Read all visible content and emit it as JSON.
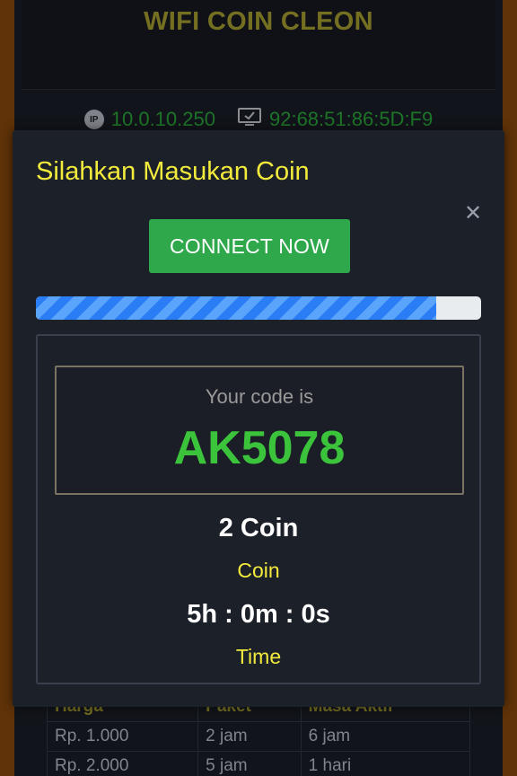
{
  "header": {
    "title": "WIFI COIN CLEON"
  },
  "info": {
    "ip_icon": "ip-badge-icon",
    "ip_icon_text": "IP",
    "ip": "10.0.10.250",
    "device_icon": "monitor-check-icon",
    "mac": "92:68:51:86:5D:F9"
  },
  "table": {
    "headers": [
      "Harga",
      "Paket",
      "Masa Aktif"
    ],
    "rows": [
      [
        "Rp. 1.000",
        "2 jam",
        "6 jam"
      ],
      [
        "Rp. 2.000",
        "5 jam",
        "1 hari"
      ]
    ]
  },
  "modal": {
    "title": "Silahkan Masukan Coin",
    "close_icon": "close-icon",
    "close_glyph": "✕",
    "connect_label": "CONNECT NOW",
    "progress": 0.9,
    "code_label": "Your code is",
    "code_value": "AK5078",
    "coin_value": "2 Coin",
    "coin_label": "Coin",
    "time_value": "5h : 0m : 0s",
    "time_label": "Time"
  },
  "colors": {
    "accent_yellow": "#f2eb3c",
    "connect_green": "#2ea84a",
    "code_green": "#3cc33c",
    "progress_blue": "#2a7df4",
    "frame_brown": "#8a4a0c"
  }
}
